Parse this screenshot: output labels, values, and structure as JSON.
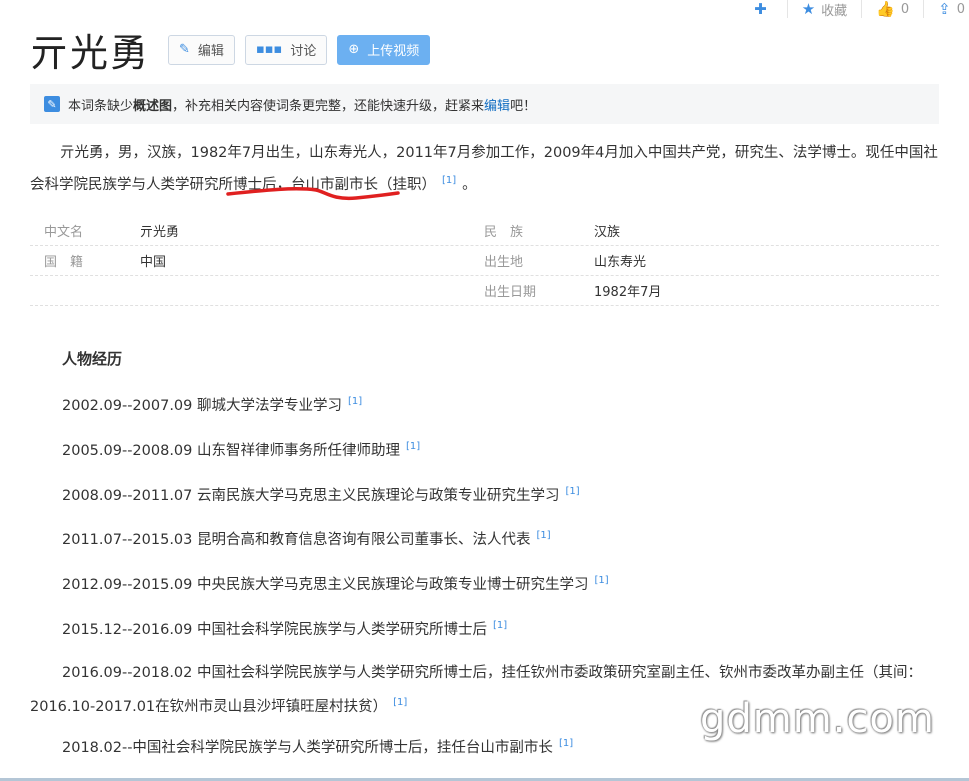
{
  "topbar": {
    "collect_label": "收藏",
    "like_count": "0",
    "share_count": "0"
  },
  "title": "亓光勇",
  "buttons": {
    "edit": "编辑",
    "discuss": "讨论",
    "upload_video": "上传视频"
  },
  "notice": {
    "prefix": "本词条缺少",
    "bold": "概述图",
    "middle": "，补充相关内容使词条更完整，还能快速升级，赶紧来",
    "link": "编辑",
    "suffix": "吧！"
  },
  "summary": {
    "line1": "亓光勇，男，汉族，1982年7月出生，山东寿光人，2011年7月参加工作，2009年4月加入中国共产党，研究生、法学博士。现任中国社会科学院民族学与人类学研究所博士后，台山市副市长（挂职）",
    "cite": "[1]",
    "end": "。"
  },
  "basic_info": [
    {
      "name": "中文名",
      "value": "亓光勇",
      "name2": "民　族",
      "value2": "汉族"
    },
    {
      "name": "国　籍",
      "value": "中国",
      "name2": "出生地",
      "value2": "山东寿光"
    },
    {
      "name": "",
      "value": "",
      "name2": "出生日期",
      "value2": "1982年7月"
    }
  ],
  "section_title": "人物经历",
  "experiences": [
    {
      "text": "2002.09--2007.09 聊城大学法学专业学习",
      "cite": "[1]"
    },
    {
      "text": "2005.09--2008.09 山东智祥律师事务所任律师助理",
      "cite": "[1]"
    },
    {
      "text": "2008.09--2011.07 云南民族大学马克思主义民族理论与政策专业研究生学习",
      "cite": "[1]"
    },
    {
      "text": "2011.07--2015.03 昆明合高和教育信息咨询有限公司董事长、法人代表",
      "cite": "[1]"
    },
    {
      "text": "2012.09--2015.09 中央民族大学马克思主义民族理论与政策专业博士研究生学习",
      "cite": "[1]"
    },
    {
      "text": "2015.12--2016.09 中国社会科学院民族学与人类学研究所博士后",
      "cite": "[1]"
    },
    {
      "text": "2016.09--2018.02 中国社会科学院民族学与人类学研究所博士后，挂任钦州市委政策研究室副主任、钦州市委改革办副主任（其间：2016.10-2017.01在钦州市灵山县沙坪镇旺屋村扶贫）",
      "cite": "[1]"
    },
    {
      "text": "2018.02--中国社会科学院民族学与人类学研究所博士后，挂任台山市副市长",
      "cite": "[1]"
    }
  ],
  "watermark": "gdmm.com",
  "colors": {
    "accent": "#3d8de0",
    "annotation": "#e02020"
  }
}
